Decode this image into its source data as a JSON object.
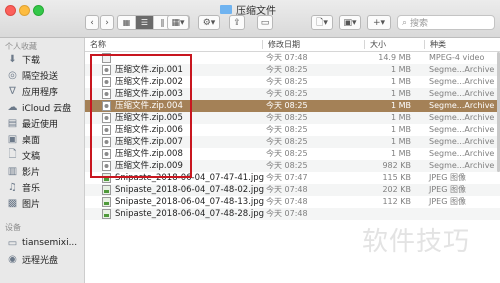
{
  "window": {
    "title": "压缩文件"
  },
  "toolbar": {
    "search_placeholder": "搜索"
  },
  "sidebar": {
    "favorites_header": "个人收藏",
    "favorites": [
      {
        "label": "下载",
        "icon": "download-icon"
      },
      {
        "label": "隔空投送",
        "icon": "airdrop-icon"
      },
      {
        "label": "应用程序",
        "icon": "applications-icon"
      },
      {
        "label": "iCloud 云盘",
        "icon": "icloud-icon"
      },
      {
        "label": "最近使用",
        "icon": "recent-icon"
      },
      {
        "label": "桌面",
        "icon": "desktop-icon"
      },
      {
        "label": "文稿",
        "icon": "documents-icon"
      },
      {
        "label": "影片",
        "icon": "movies-icon"
      },
      {
        "label": "音乐",
        "icon": "music-icon"
      },
      {
        "label": "图片",
        "icon": "pictures-icon"
      }
    ],
    "devices_header": "设备",
    "devices": [
      {
        "label": "tiansemixi...",
        "icon": "computer-icon"
      },
      {
        "label": "远程光盘",
        "icon": "remote-disc-icon"
      }
    ]
  },
  "columns": {
    "name": "名称",
    "date": "修改日期",
    "size": "大小",
    "kind": "种类"
  },
  "files": [
    {
      "name": "",
      "date": "今天 07:48",
      "size": "14.9 MB",
      "kind": "MPEG-4 video",
      "icon": "video-icon"
    },
    {
      "name": "压缩文件.zip.001",
      "date": "今天 08:25",
      "size": "1 MB",
      "kind": "Segme...Archive",
      "icon": "archive-icon"
    },
    {
      "name": "压缩文件.zip.002",
      "date": "今天 08:25",
      "size": "1 MB",
      "kind": "Segme...Archive",
      "icon": "archive-icon"
    },
    {
      "name": "压缩文件.zip.003",
      "date": "今天 08:25",
      "size": "1 MB",
      "kind": "Segme...Archive",
      "icon": "archive-icon"
    },
    {
      "name": "压缩文件.zip.004",
      "date": "今天 08:25",
      "size": "1 MB",
      "kind": "Segme...Archive",
      "icon": "archive-icon",
      "selected": true
    },
    {
      "name": "压缩文件.zip.005",
      "date": "今天 08:25",
      "size": "1 MB",
      "kind": "Segme...Archive",
      "icon": "archive-icon"
    },
    {
      "name": "压缩文件.zip.006",
      "date": "今天 08:25",
      "size": "1 MB",
      "kind": "Segme...Archive",
      "icon": "archive-icon"
    },
    {
      "name": "压缩文件.zip.007",
      "date": "今天 08:25",
      "size": "1 MB",
      "kind": "Segme...Archive",
      "icon": "archive-icon"
    },
    {
      "name": "压缩文件.zip.008",
      "date": "今天 08:25",
      "size": "1 MB",
      "kind": "Segme...Archive",
      "icon": "archive-icon"
    },
    {
      "name": "压缩文件.zip.009",
      "date": "今天 08:25",
      "size": "982 KB",
      "kind": "Segme...Archive",
      "icon": "archive-icon"
    },
    {
      "name": "Snipaste_2018-06-04_07-47-41.jpg",
      "date": "今天 07:47",
      "size": "115 KB",
      "kind": "JPEG 图像",
      "icon": "image-icon"
    },
    {
      "name": "Snipaste_2018-06-04_07-48-02.jpg",
      "date": "今天 07:48",
      "size": "202 KB",
      "kind": "JPEG 图像",
      "icon": "image-icon"
    },
    {
      "name": "Snipaste_2018-06-04_07-48-13.jpg",
      "date": "今天 07:48",
      "size": "112 KB",
      "kind": "JPEG 图像",
      "icon": "image-icon"
    },
    {
      "name": "Snipaste_2018-06-04_07-48-28.jpg",
      "date": "今天 07:48",
      "size": "",
      "kind": "",
      "icon": "image-icon"
    }
  ],
  "watermark": "软件技巧"
}
